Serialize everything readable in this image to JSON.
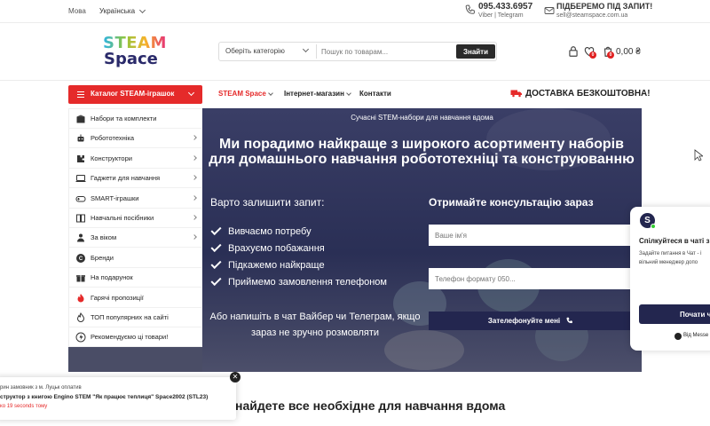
{
  "topbar": {
    "lang_label": "Мова",
    "lang_value": "Українська",
    "phone": "095.433.6957",
    "phone_sub": "Viber | Telegram",
    "mail_head": "ПІДБЕРЕМО ПІД ЗАПИТ!",
    "mail_addr": "sell@steamspace.com.ua"
  },
  "logo": {
    "line1": "STEAM",
    "line2": "Space"
  },
  "search": {
    "category": "Оберіть категорію",
    "placeholder": "Пошук по товарам...",
    "button": "Знайти"
  },
  "cart": {
    "wishlist_count": "0",
    "cart_count": "0",
    "total": "0,00 ₴"
  },
  "nav": {
    "catalog": "Каталог STEAM-іграшок",
    "links": [
      "STEAM Space",
      "Інтернет-магазин",
      "Контакти"
    ],
    "delivery": "ДОСТАВКА БЕЗКОШТОВНА!"
  },
  "sidebar": {
    "items": [
      {
        "label": "Набори та комплекти",
        "icon": "box-icon",
        "arrow": false
      },
      {
        "label": "Робототехніка",
        "icon": "robot-icon",
        "arrow": true
      },
      {
        "label": "Конструктори",
        "icon": "puzzle-icon",
        "arrow": true
      },
      {
        "label": "Гаджети для навчання",
        "icon": "tablet-icon",
        "arrow": true
      },
      {
        "label": "SMART-іграшки",
        "icon": "gamepad-icon",
        "arrow": true
      },
      {
        "label": "Навчальні посібники",
        "icon": "book-icon",
        "arrow": true
      },
      {
        "label": "За віком",
        "icon": "age-icon",
        "arrow": true
      },
      {
        "label": "Бренди",
        "icon": "brand-icon",
        "arrow": false
      },
      {
        "label": "На подарунок",
        "icon": "gift-icon",
        "arrow": false
      },
      {
        "label": "Гарячі пропозиції",
        "icon": "fire-icon",
        "arrow": false
      },
      {
        "label": "ТОП популярних на сайті",
        "icon": "top-icon",
        "arrow": false
      },
      {
        "label": "Рекомендуємо ці товари!",
        "icon": "star-badge-icon",
        "arrow": false
      }
    ]
  },
  "hero": {
    "subtitle": "Сучасні STEM-набори для навчання вдома",
    "title": "Ми порадимо найкраще з широкого асортименту наборів для домашнього навчання робототехніці та конструюванню",
    "left_heading": "Варто залишити запит:",
    "checks": [
      "Вивчаємо потребу",
      "Врахуємо побажання",
      "Підкажемо найкраще",
      "Приймемо замовлення телефоном"
    ],
    "message": "Або напишіть в чат Вайбер чи Телеграм, якщо зараз не зручно розмовляти",
    "form_heading": "Отримайте консультацію зараз",
    "name_placeholder": "Ваше ім'я",
    "phone_placeholder": "Телефон формату 050...",
    "call_button": "Зателефонуйте мені"
  },
  "chat": {
    "title": "Спілкуйтеся в чаті з",
    "text1": "Задайте питання в Чат - і",
    "text2": "вільний менеджер допо",
    "start_button": "Почати ч",
    "messenger": "Від Messe"
  },
  "popup": {
    "line1": "рин замовник з м. Луцьк оплатив",
    "line2": "структор з книгою Engino STEM \"Як працює теплиця\" Space2002 (STL23)",
    "line3": "ко 19 seconds тому"
  },
  "bottom": {
    "heading": "найдете все необхідне для навчання вдома"
  },
  "colors": {
    "accent": "#e52a2a",
    "navy": "#23264f",
    "hero": "#2f3358"
  }
}
